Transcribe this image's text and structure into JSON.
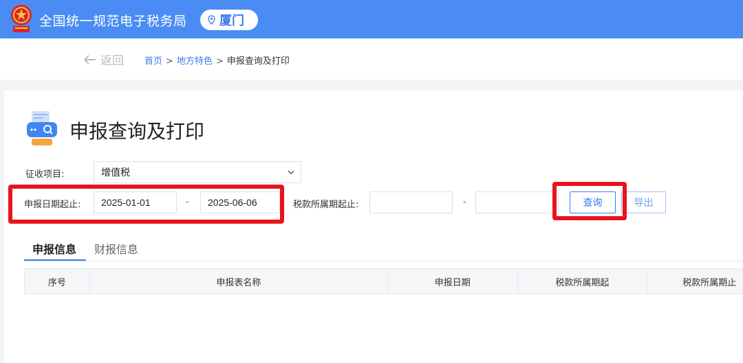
{
  "header": {
    "title": "全国统一规范电子税务局",
    "city": "厦门",
    "brand_color": "#4a8cf4"
  },
  "nav": {
    "back_label": "返回",
    "breadcrumb": [
      "首页",
      "地方特色",
      "申报查询及打印"
    ],
    "separator": ">"
  },
  "page": {
    "title": "申报查询及打印"
  },
  "form": {
    "tax_item_label": "征收项目:",
    "tax_item_value": "增值税",
    "declare_date_label": "申报日期起止:",
    "declare_date_from": "2025-01-01",
    "declare_date_to": "2025-06-06",
    "range_dash": "-",
    "tax_period_label": "税款所属期起止:",
    "tax_period_from": "",
    "tax_period_to": ""
  },
  "buttons": {
    "query": "查询",
    "export": "导出"
  },
  "tabs": [
    {
      "label": "申报信息",
      "active": true
    },
    {
      "label": "财报信息",
      "active": false
    }
  ],
  "table": {
    "columns": [
      "序号",
      "申报表名称",
      "申报日期",
      "税款所属期起",
      "税款所属期止"
    ]
  },
  "colors": {
    "accent": "#3a7bf0",
    "highlight": "#e8141c"
  }
}
